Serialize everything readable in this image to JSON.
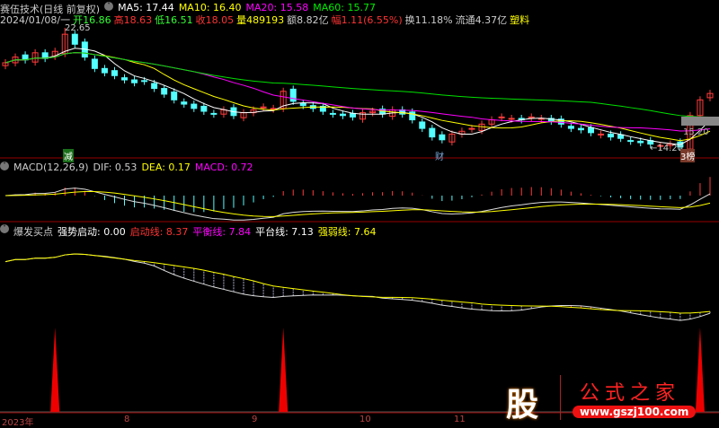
{
  "header": {
    "title": "赛伍技术(日线 前复权)",
    "ma5": "MA5: 17.44",
    "ma10": "MA10: 16.40",
    "ma20": "MA20: 15.58",
    "ma60": "MA60: 15.77",
    "date": "2024/01/08/一",
    "open": "开16.86",
    "high": "高18.63",
    "low": "低16.51",
    "close": "收18.05",
    "volume": "量489193",
    "amount": "额8.82亿",
    "change": "幅1.11(6.55%)",
    "turnover": "换11.18%",
    "float": "流通4.37亿",
    "sector": "塑料"
  },
  "annotations": {
    "high_label": "22.65",
    "low_label": "←14.20",
    "mark1": "减",
    "mark2": "财",
    "mark3": "3榜",
    "price_box": "15.20"
  },
  "macd": {
    "title": "MACD(12,26,9)",
    "dif": "DIF: 0.53",
    "dea": "DEA: 0.17",
    "macd": "MACD: 0.72"
  },
  "ind": {
    "title": "爆发买点",
    "strong": "强势启动: 0.00",
    "start": "启动线: 8.37",
    "balance": "平衡线: 7.84",
    "platform": "平台线: 7.13",
    "weak": "强弱线: 7.64"
  },
  "xaxis": [
    "2023年",
    "8",
    "9",
    "10",
    "11"
  ],
  "logo": {
    "char": "股",
    "name": "公式之家",
    "url": "www.gszj100.com"
  },
  "colors": {
    "up": "#ff3c3c",
    "down": "#54ffff",
    "ma5": "#ffffff",
    "ma10": "#ffff00",
    "ma20": "#ff00ff",
    "ma60": "#00e000"
  },
  "chart_data": {
    "type": "candlestick",
    "title": "赛伍技术(日线 前复权)",
    "closes": [
      20.2,
      20.6,
      20.4,
      20.9,
      20.5,
      21.0,
      22.2,
      21.5,
      20.6,
      19.8,
      19.5,
      19.3,
      19.0,
      18.8,
      18.9,
      18.4,
      18.0,
      17.6,
      17.3,
      17.0,
      16.8,
      16.6,
      16.9,
      16.5,
      16.7,
      16.9,
      17.1,
      17.0,
      18.2,
      17.5,
      17.2,
      17.0,
      16.8,
      16.6,
      16.5,
      16.4,
      16.7,
      16.8,
      16.6,
      16.9,
      16.6,
      16.2,
      15.6,
      15.0,
      14.8,
      15.2,
      15.4,
      15.6,
      15.9,
      16.2,
      16.4,
      16.3,
      16.2,
      16.4,
      16.3,
      16.1,
      15.9,
      15.6,
      15.5,
      15.3,
      15.2,
      15.0,
      14.9,
      14.7,
      14.6,
      14.5,
      14.4,
      14.5,
      14.3,
      16.5,
      17.6,
      18.05
    ],
    "max": 22.65,
    "min": 14.2,
    "signals": [
      5,
      28,
      70
    ]
  }
}
